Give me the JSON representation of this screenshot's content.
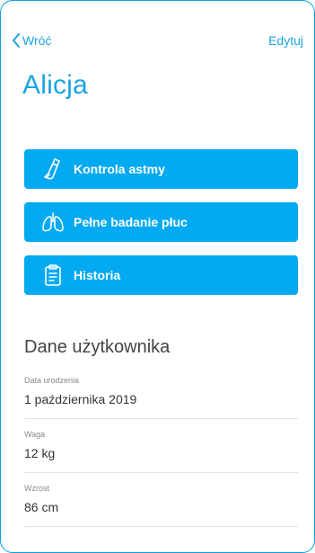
{
  "nav": {
    "back_label": "Wróć",
    "edit_label": "Edytuj"
  },
  "profile": {
    "name": "Alicja"
  },
  "actions": [
    {
      "label": "Kontrola astmy",
      "icon": "inhaler-icon"
    },
    {
      "label": "Pełne badanie płuc",
      "icon": "lungs-icon"
    },
    {
      "label": "Historia",
      "icon": "clipboard-icon"
    }
  ],
  "user_data": {
    "section_title": "Dane użytkownika",
    "fields": [
      {
        "label": "Data urodzenia",
        "value": "1 października 2019"
      },
      {
        "label": "Waga",
        "value": "12 kg"
      },
      {
        "label": "Wzrost",
        "value": "86 cm"
      }
    ]
  },
  "colors": {
    "accent": "#1aa4e4",
    "button": "#03a9f1",
    "frame_border": "#0aa0e0"
  }
}
